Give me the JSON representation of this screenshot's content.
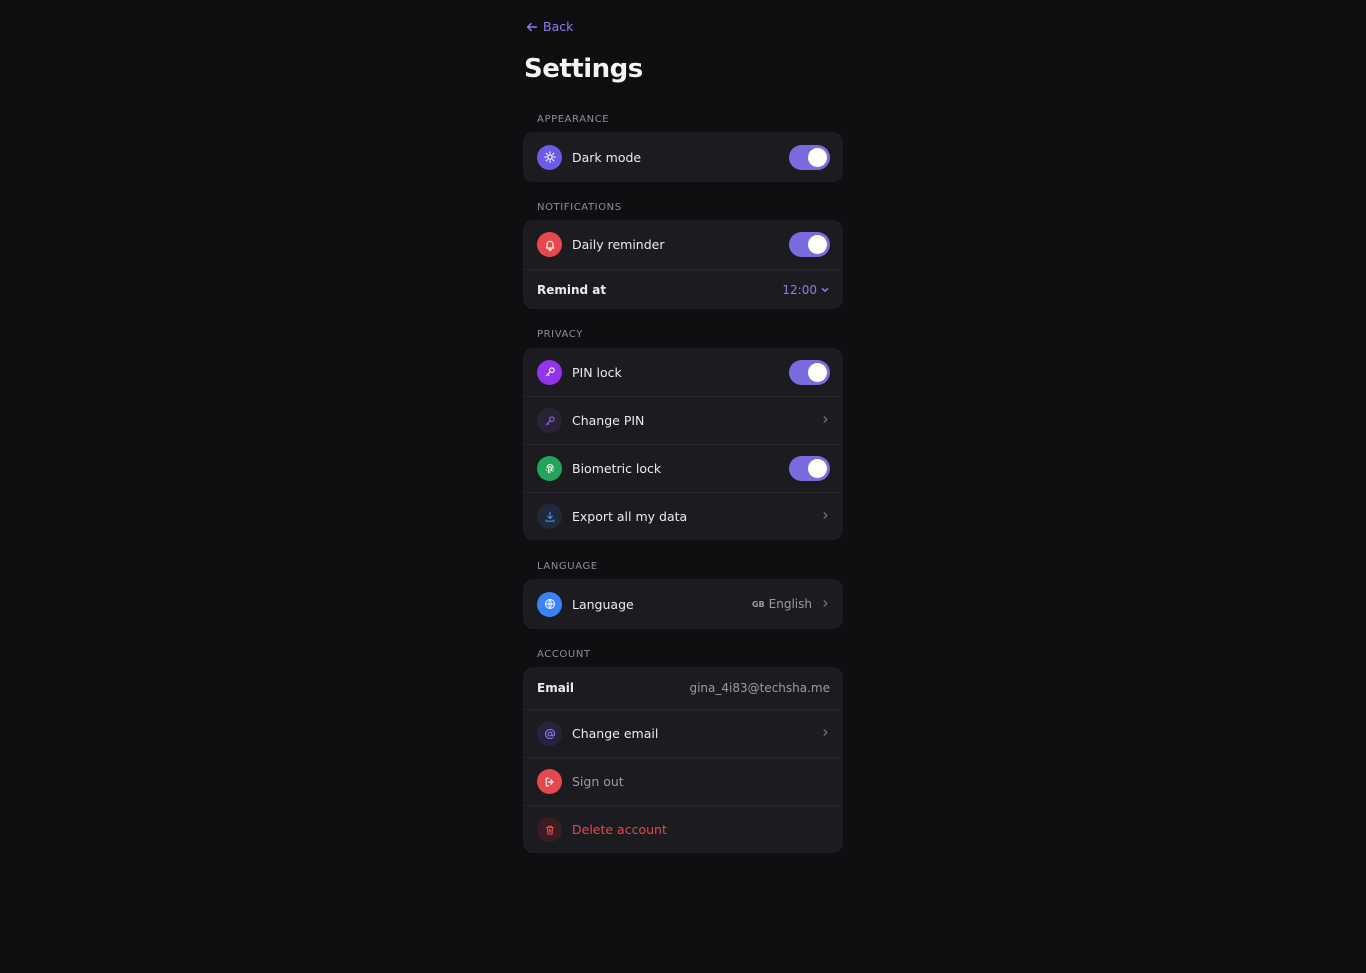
{
  "nav": {
    "back_label": "Back"
  },
  "page_title": "Settings",
  "sections": {
    "appearance": {
      "label": "Appearance",
      "dark_mode": {
        "label": "Dark mode",
        "enabled": true
      }
    },
    "notifications": {
      "label": "Notifications",
      "daily_reminder": {
        "label": "Daily reminder",
        "enabled": true
      },
      "remind_at": {
        "label": "Remind at",
        "value": "12:00"
      }
    },
    "privacy": {
      "label": "Privacy",
      "pin_lock": {
        "label": "PIN lock",
        "enabled": true
      },
      "change_pin": {
        "label": "Change PIN"
      },
      "biometric_lock": {
        "label": "Biometric lock",
        "enabled": true
      },
      "export_data": {
        "label": "Export all my data"
      }
    },
    "language": {
      "label": "Language",
      "language_row": {
        "label": "Language",
        "flag": "GB",
        "value": "English"
      }
    },
    "account": {
      "label": "Account",
      "email": {
        "label": "Email",
        "value": "gina_4i83@techsha.me"
      },
      "change_email": {
        "label": "Change email"
      },
      "sign_out": {
        "label": "Sign out"
      },
      "delete_account": {
        "label": "Delete account"
      }
    }
  },
  "colors": {
    "background": "#0f0f11",
    "card": "#1c1c20",
    "accent": "#7a6cdf",
    "danger": "#e5484d",
    "success": "#22a55b",
    "info": "#3b82f6"
  }
}
